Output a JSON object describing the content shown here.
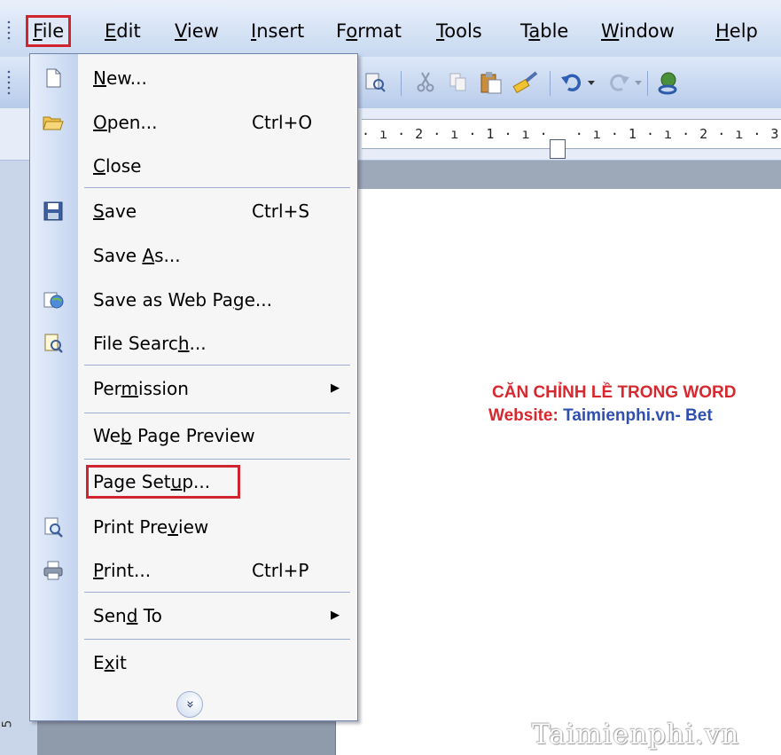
{
  "menubar": {
    "items": [
      {
        "pre": "",
        "ul": "F",
        "post": "ile"
      },
      {
        "pre": "",
        "ul": "E",
        "post": "dit"
      },
      {
        "pre": "",
        "ul": "V",
        "post": "iew"
      },
      {
        "pre": "",
        "ul": "I",
        "post": "nsert"
      },
      {
        "pre": "F",
        "ul": "o",
        "post": "rmat"
      },
      {
        "pre": "",
        "ul": "T",
        "post": "ools"
      },
      {
        "pre": "T",
        "ul": "a",
        "post": "ble"
      },
      {
        "pre": "",
        "ul": "W",
        "post": "indow"
      },
      {
        "pre": "",
        "ul": "H",
        "post": "elp"
      }
    ]
  },
  "ruler": {
    "text": "· ı · 2 · ı · 1 · ı ·   · ı · 1 · ı · 2 · ı · 3"
  },
  "file_menu": {
    "items": [
      {
        "pre": "",
        "ul": "N",
        "post": "ew...",
        "shortcut": "",
        "icon": "new-document-icon"
      },
      {
        "pre": "",
        "ul": "O",
        "post": "pen...",
        "shortcut": "Ctrl+O",
        "icon": "open-folder-icon"
      },
      {
        "pre": "",
        "ul": "C",
        "post": "lose",
        "shortcut": "",
        "icon": ""
      },
      {
        "pre": "",
        "ul": "S",
        "post": "ave",
        "shortcut": "Ctrl+S",
        "icon": "save-disk-icon"
      },
      {
        "pre": "Save ",
        "ul": "A",
        "post": "s...",
        "shortcut": "",
        "icon": ""
      },
      {
        "pre": "Save as Web Pa",
        "ul": "g",
        "post": "e...",
        "shortcut": "",
        "icon": "web-page-icon"
      },
      {
        "pre": "File Searc",
        "ul": "h",
        "post": "...",
        "shortcut": "",
        "icon": "file-search-icon"
      },
      {
        "pre": "Per",
        "ul": "m",
        "post": "ission",
        "shortcut": "",
        "icon": ""
      },
      {
        "pre": "We",
        "ul": "b",
        "post": " Page Preview",
        "shortcut": "",
        "icon": ""
      },
      {
        "pre": "Page Set",
        "ul": "u",
        "post": "p...",
        "shortcut": "",
        "icon": ""
      },
      {
        "pre": "Print Pre",
        "ul": "v",
        "post": "iew",
        "shortcut": "",
        "icon": "print-preview-icon"
      },
      {
        "pre": "",
        "ul": "P",
        "post": "rint...",
        "shortcut": "Ctrl+P",
        "icon": "printer-icon"
      },
      {
        "pre": "Sen",
        "ul": "d",
        "post": " To",
        "shortcut": "",
        "icon": ""
      },
      {
        "pre": "E",
        "ul": "x",
        "post": "it",
        "shortcut": "",
        "icon": ""
      }
    ]
  },
  "document": {
    "title": "CĂN CHỈNH LỀ TRONG WORD",
    "website_label": "Website:",
    "website_value": "Taimienphi.vn- Bet",
    "watermark": "Taimienphi.vn"
  },
  "vertical_ruler_mark": "5",
  "colors": {
    "highlight_red": "#d0252e",
    "title_red": "#d8282f",
    "link_blue": "#2f4fb1",
    "menu_blue": "#c7d8f0"
  }
}
